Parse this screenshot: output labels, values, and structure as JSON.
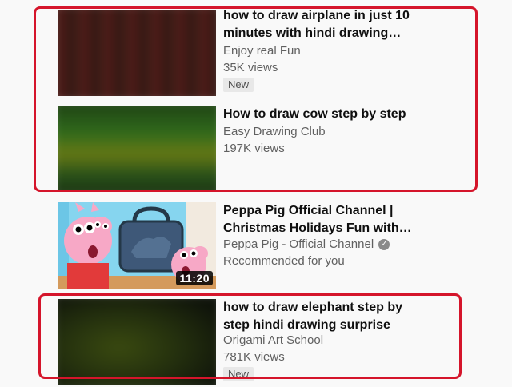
{
  "videos": [
    {
      "title": "how to draw airplane in just 10 minutes with hindi drawing…",
      "channel": "Enjoy real Fun",
      "meta": "35K views",
      "badge": "New"
    },
    {
      "title": "How to draw cow step by step",
      "channel": "Easy Drawing Club",
      "meta": "197K views"
    },
    {
      "title": "Peppa Pig Official Channel | Christmas Holidays Fun with…",
      "channel": "Peppa Pig - Official Channel",
      "meta": "Recommended for you",
      "duration": "11:20"
    },
    {
      "title": "how to draw elephant step by step hindi drawing surprise",
      "channel": "Origami Art School",
      "meta": "781K views",
      "badge": "New"
    }
  ],
  "icons": {
    "verified": "verified-check-icon"
  },
  "colors": {
    "highlight": "#d5152b",
    "secondary_text": "#606060",
    "badge_bg": "#e8e8e8"
  }
}
